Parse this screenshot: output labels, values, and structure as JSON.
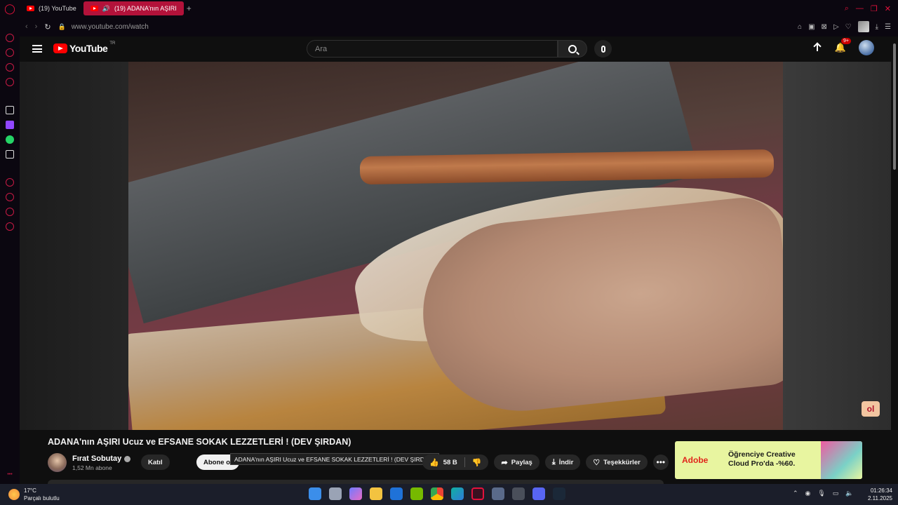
{
  "browser": {
    "tabs": [
      {
        "label": "(19) YouTube",
        "active": false
      },
      {
        "label": "(19) ADANA'nın AŞIRI",
        "active": true
      }
    ],
    "new_tab": "+",
    "url": "www.youtube.com/watch",
    "accent": "#e4123c"
  },
  "youtube": {
    "logo_text": "YouTube",
    "logo_country": "TR",
    "search_placeholder": "Ara",
    "notification_count": "9+",
    "video": {
      "title": "ADANA'nın AŞIRI Ucuz ve EFSANE SOKAK LEZZETLERİ ! (DEV ŞIRDAN)",
      "tooltip": "ADANA'nın AŞIRI Ucuz ve EFSANE SOKAK LEZZETLERİ ! (DEV ŞIRDAN)",
      "watermark": "ol"
    },
    "channel": {
      "name": "Fırat Sobutay",
      "subscribers": "1,52 Mn abone",
      "join_label": "Katıl",
      "subscribe_label": "Abone ol"
    },
    "actions": {
      "like_count": "58 B",
      "share_label": "Paylaş",
      "download_label": "İndir",
      "thanks_label": "Teşekkürler",
      "more_label": "•••"
    },
    "ad": {
      "brand": "Adobe",
      "text": "Öğrenciye Creative Cloud Pro'da -%60."
    }
  },
  "taskbar": {
    "temperature": "17°C",
    "weather": "Parçalı bulutlu",
    "time": "01:26:34",
    "date": "2.11.2025"
  }
}
